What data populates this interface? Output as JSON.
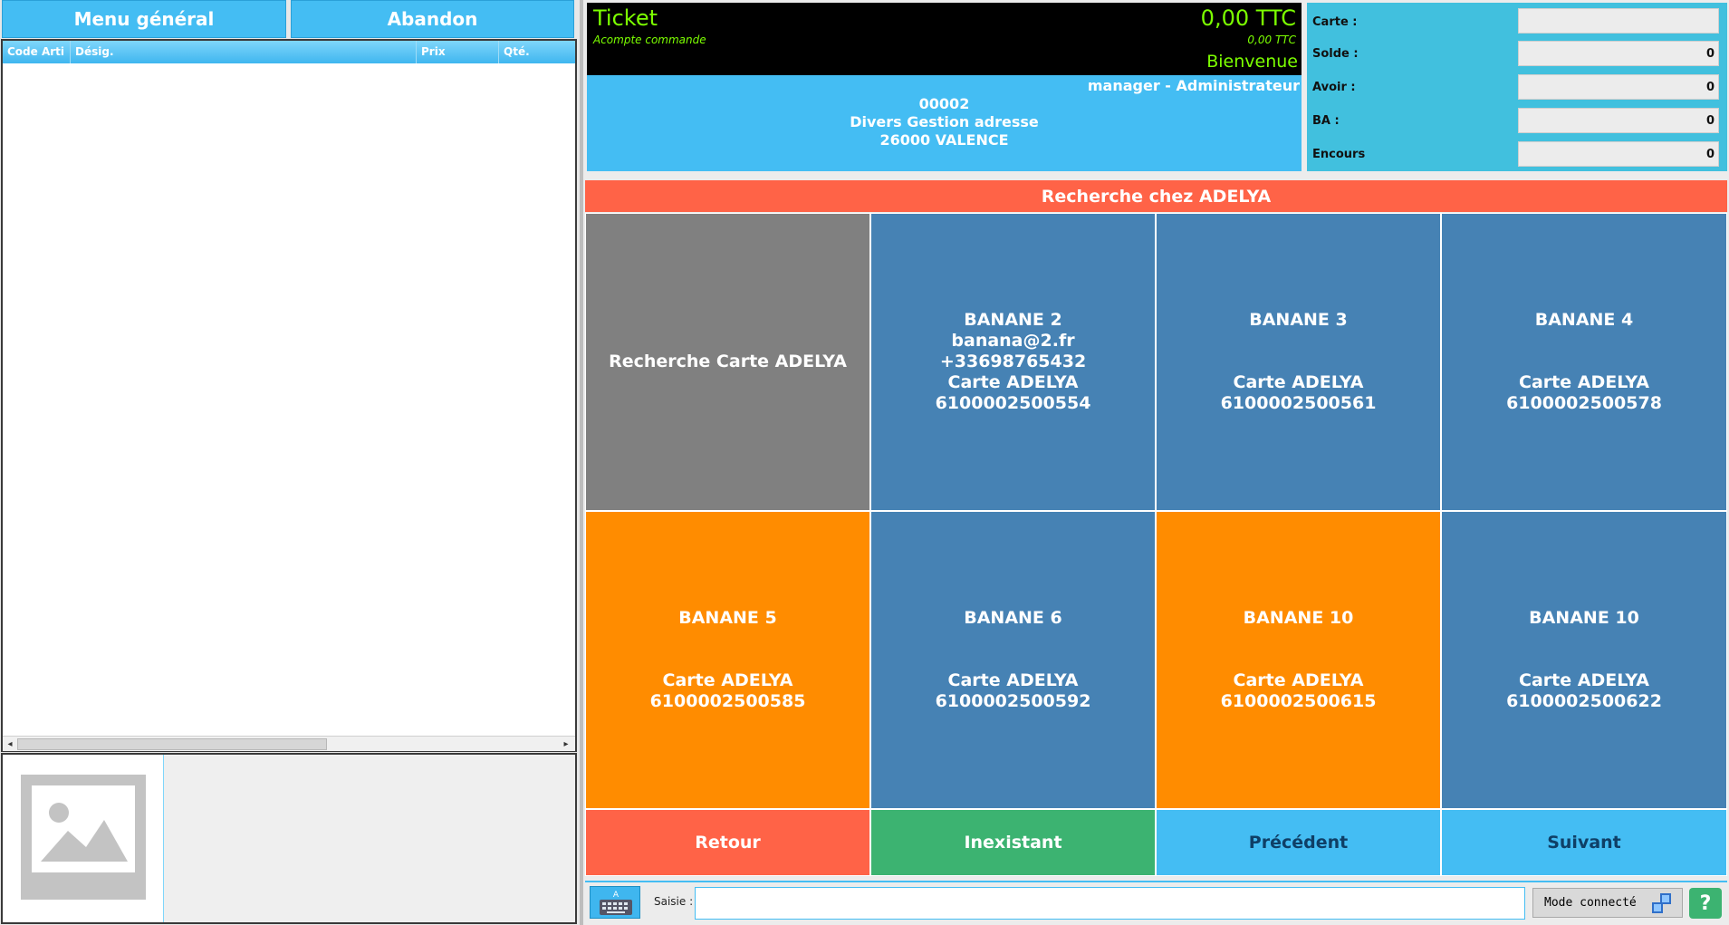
{
  "left": {
    "menu_label": "Menu général",
    "abandon_label": "Abandon",
    "columns": [
      "Code Arti",
      "Désig.",
      "Prix",
      "Qté."
    ]
  },
  "ticket": {
    "title": "Ticket",
    "total": "0,00 TTC",
    "subtitle": "Acompte commande",
    "sub_total": "0,00 TTC",
    "welcome": "Bienvenue",
    "user": "manager - Administrateur",
    "client_code": "00002",
    "client_name": "Divers Gestion adresse",
    "client_city": "26000 VALENCE"
  },
  "account": {
    "carte_label": "Carte :",
    "carte_value": "",
    "solde_label": "Solde :",
    "solde_value": "0",
    "avoir_label": "Avoir :",
    "avoir_value": "0",
    "ba_label": "BA :",
    "ba_value": "0",
    "encours_label": "Encours",
    "encours_value": "0"
  },
  "search_title": "Recherche chez ADELYA",
  "tiles": [
    {
      "lines": [
        "Recherche Carte ADELYA"
      ],
      "color": "grey"
    },
    {
      "lines": [
        "BANANE 2",
        "banana@2.fr",
        "+33698765432",
        "Carte ADELYA",
        "6100002500554"
      ],
      "color": "blue"
    },
    {
      "lines": [
        "BANANE 3",
        "",
        "",
        "Carte ADELYA",
        "6100002500561"
      ],
      "color": "blue"
    },
    {
      "lines": [
        "BANANE 4",
        "",
        "",
        "Carte ADELYA",
        "6100002500578"
      ],
      "color": "blue"
    },
    {
      "lines": [
        "BANANE 5",
        "",
        "",
        "Carte ADELYA",
        "6100002500585"
      ],
      "color": "orange"
    },
    {
      "lines": [
        "BANANE 6",
        "",
        "",
        "Carte ADELYA",
        "6100002500592"
      ],
      "color": "blue"
    },
    {
      "lines": [
        "BANANE 10",
        "",
        "",
        "Carte ADELYA",
        "6100002500615"
      ],
      "color": "orange"
    },
    {
      "lines": [
        "BANANE 10",
        "",
        "",
        "Carte ADELYA",
        "6100002500622"
      ],
      "color": "blue"
    }
  ],
  "actions": {
    "retour": "Retour",
    "inexistant": "Inexistant",
    "precedent": "Précédent",
    "suivant": "Suivant"
  },
  "saisie": {
    "label": "Saisie :",
    "value": "",
    "mode": "Mode connecté",
    "help": "?"
  },
  "icons": {
    "keyboard": "keyboard-icon",
    "image": "image-placeholder-icon",
    "mode": "network-icon"
  }
}
